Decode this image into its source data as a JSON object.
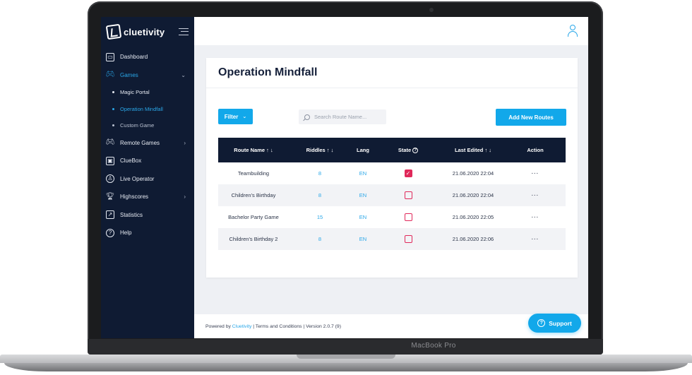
{
  "device": {
    "brand_label": "MacBook Pro"
  },
  "brand": {
    "name": "cluetivity",
    "accent_color": "#2aa7e8",
    "sidebar_color": "#0f1b33",
    "danger_color": "#e0285a"
  },
  "sidebar": {
    "items": [
      {
        "label": "Dashboard",
        "icon": "monitor-icon"
      },
      {
        "label": "Games",
        "icon": "gamepad-icon",
        "active": true,
        "expanded": true
      },
      {
        "label": "Remote Games",
        "icon": "gamepad-icon"
      },
      {
        "label": "ClueBox",
        "icon": "box-icon"
      },
      {
        "label": "Live Operator",
        "icon": "operator-icon"
      },
      {
        "label": "Highscores",
        "icon": "trophy-icon"
      },
      {
        "label": "Statistics",
        "icon": "chart-icon"
      },
      {
        "label": "Help",
        "icon": "help-icon"
      }
    ],
    "games_subitems": [
      {
        "label": "Magic Portal"
      },
      {
        "label": "Operation Mindfall",
        "active": true
      },
      {
        "label": "Custom Game"
      }
    ]
  },
  "page": {
    "title": "Operation Mindfall",
    "filter_label": "Filter",
    "search_placeholder": "Search Route Name...",
    "add_button": "Add New Routes"
  },
  "table": {
    "headers": {
      "route_name": "Route Name ↑ ↓",
      "riddles": "Riddles ↑ ↓",
      "lang": "Lang",
      "state": "State",
      "last_edited": "Last Edited ↑ ↓",
      "action": "Action"
    },
    "rows": [
      {
        "route_name": "Teambuilding",
        "riddles": "8",
        "lang": "EN",
        "state": true,
        "last_edited": "21.06.2020 22:04",
        "action": "···"
      },
      {
        "route_name": "Children's Birthday",
        "riddles": "8",
        "lang": "EN",
        "state": false,
        "last_edited": "21.06.2020 22:04",
        "action": "···"
      },
      {
        "route_name": "Bachelor Party Game",
        "riddles": "15",
        "lang": "EN",
        "state": false,
        "last_edited": "21.06.2020 22:05",
        "action": "···"
      },
      {
        "route_name": "Children's Birthday 2",
        "riddles": "8",
        "lang": "EN",
        "state": false,
        "last_edited": "21.06.2020 22:06",
        "action": "···"
      }
    ]
  },
  "footer": {
    "powered_by": "Powered by",
    "powered_by_link": "Cluetivity",
    "separator": "|",
    "terms": "Terms and Conditions",
    "version": "Version 2.0.7 (9)",
    "support_label": "Support"
  }
}
